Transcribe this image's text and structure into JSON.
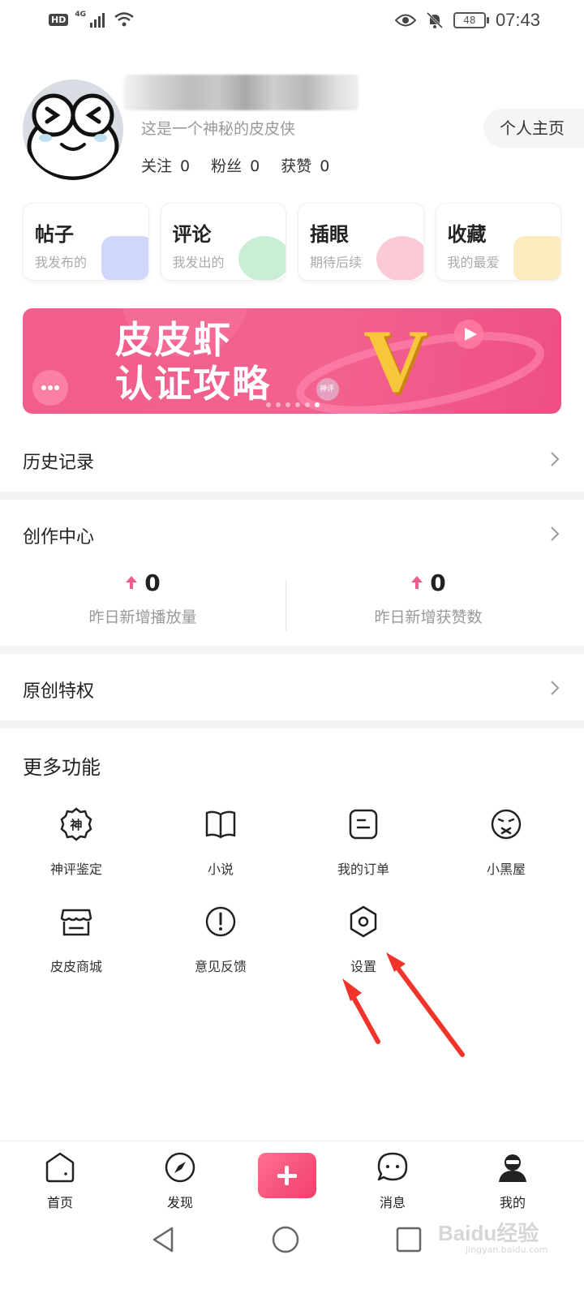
{
  "status_bar": {
    "hd": "HD",
    "network": "4G",
    "battery": "48",
    "time": "07:43"
  },
  "profile": {
    "bio": "这是一个神秘的皮皮侠",
    "follow_label": "关注",
    "follow_count": "0",
    "fans_label": "粉丝",
    "fans_count": "0",
    "likes_label": "获赞",
    "likes_count": "0",
    "homepage_label": "个人主页"
  },
  "cards": [
    {
      "title": "帖子",
      "sub": "我发布的",
      "accent": "#aab6f5"
    },
    {
      "title": "评论",
      "sub": "我发出的",
      "accent": "#9fe0b2"
    },
    {
      "title": "插眼",
      "sub": "期待后续",
      "accent": "#f7a0b3"
    },
    {
      "title": "收藏",
      "sub": "我的最爱",
      "accent": "#f8dc8c"
    }
  ],
  "banner": {
    "line1": "皮皮虾",
    "line2": "认证攻略",
    "badge": "神评",
    "letter": "V",
    "slide_count": 6,
    "active_slide": 6,
    "accent": "#f25d8b"
  },
  "history": {
    "label": "历史记录"
  },
  "creation_center": {
    "label": "创作中心",
    "stats": [
      {
        "value": "0",
        "label": "昨日新增播放量"
      },
      {
        "value": "0",
        "label": "昨日新增获赞数"
      }
    ]
  },
  "original_privilege": {
    "label": "原创特权"
  },
  "more_functions": {
    "title": "更多功能",
    "items": [
      {
        "label": "神评鉴定",
        "icon": "shenping-badge-icon",
        "glyph": "神"
      },
      {
        "label": "小说",
        "icon": "book-icon"
      },
      {
        "label": "我的订单",
        "icon": "order-icon"
      },
      {
        "label": "小黑屋",
        "icon": "sad-face-icon"
      },
      {
        "label": "皮皮商城",
        "icon": "shop-icon"
      },
      {
        "label": "意见反馈",
        "icon": "feedback-icon"
      },
      {
        "label": "设置",
        "icon": "settings-icon"
      }
    ]
  },
  "bottom_nav": {
    "items": [
      {
        "label": "首页",
        "icon": "home-icon"
      },
      {
        "label": "发现",
        "icon": "compass-icon"
      },
      {
        "label": "",
        "icon": "add-icon"
      },
      {
        "label": "消息",
        "icon": "message-icon"
      },
      {
        "label": "我的",
        "icon": "profile-icon"
      }
    ]
  },
  "watermark": {
    "text": "Baidu经验",
    "sub": "jingyan.baidu.com"
  },
  "colors": {
    "brand_pink": "#f25d8b",
    "arrow_red": "#f0342a",
    "divider": "#f3f3f3"
  }
}
